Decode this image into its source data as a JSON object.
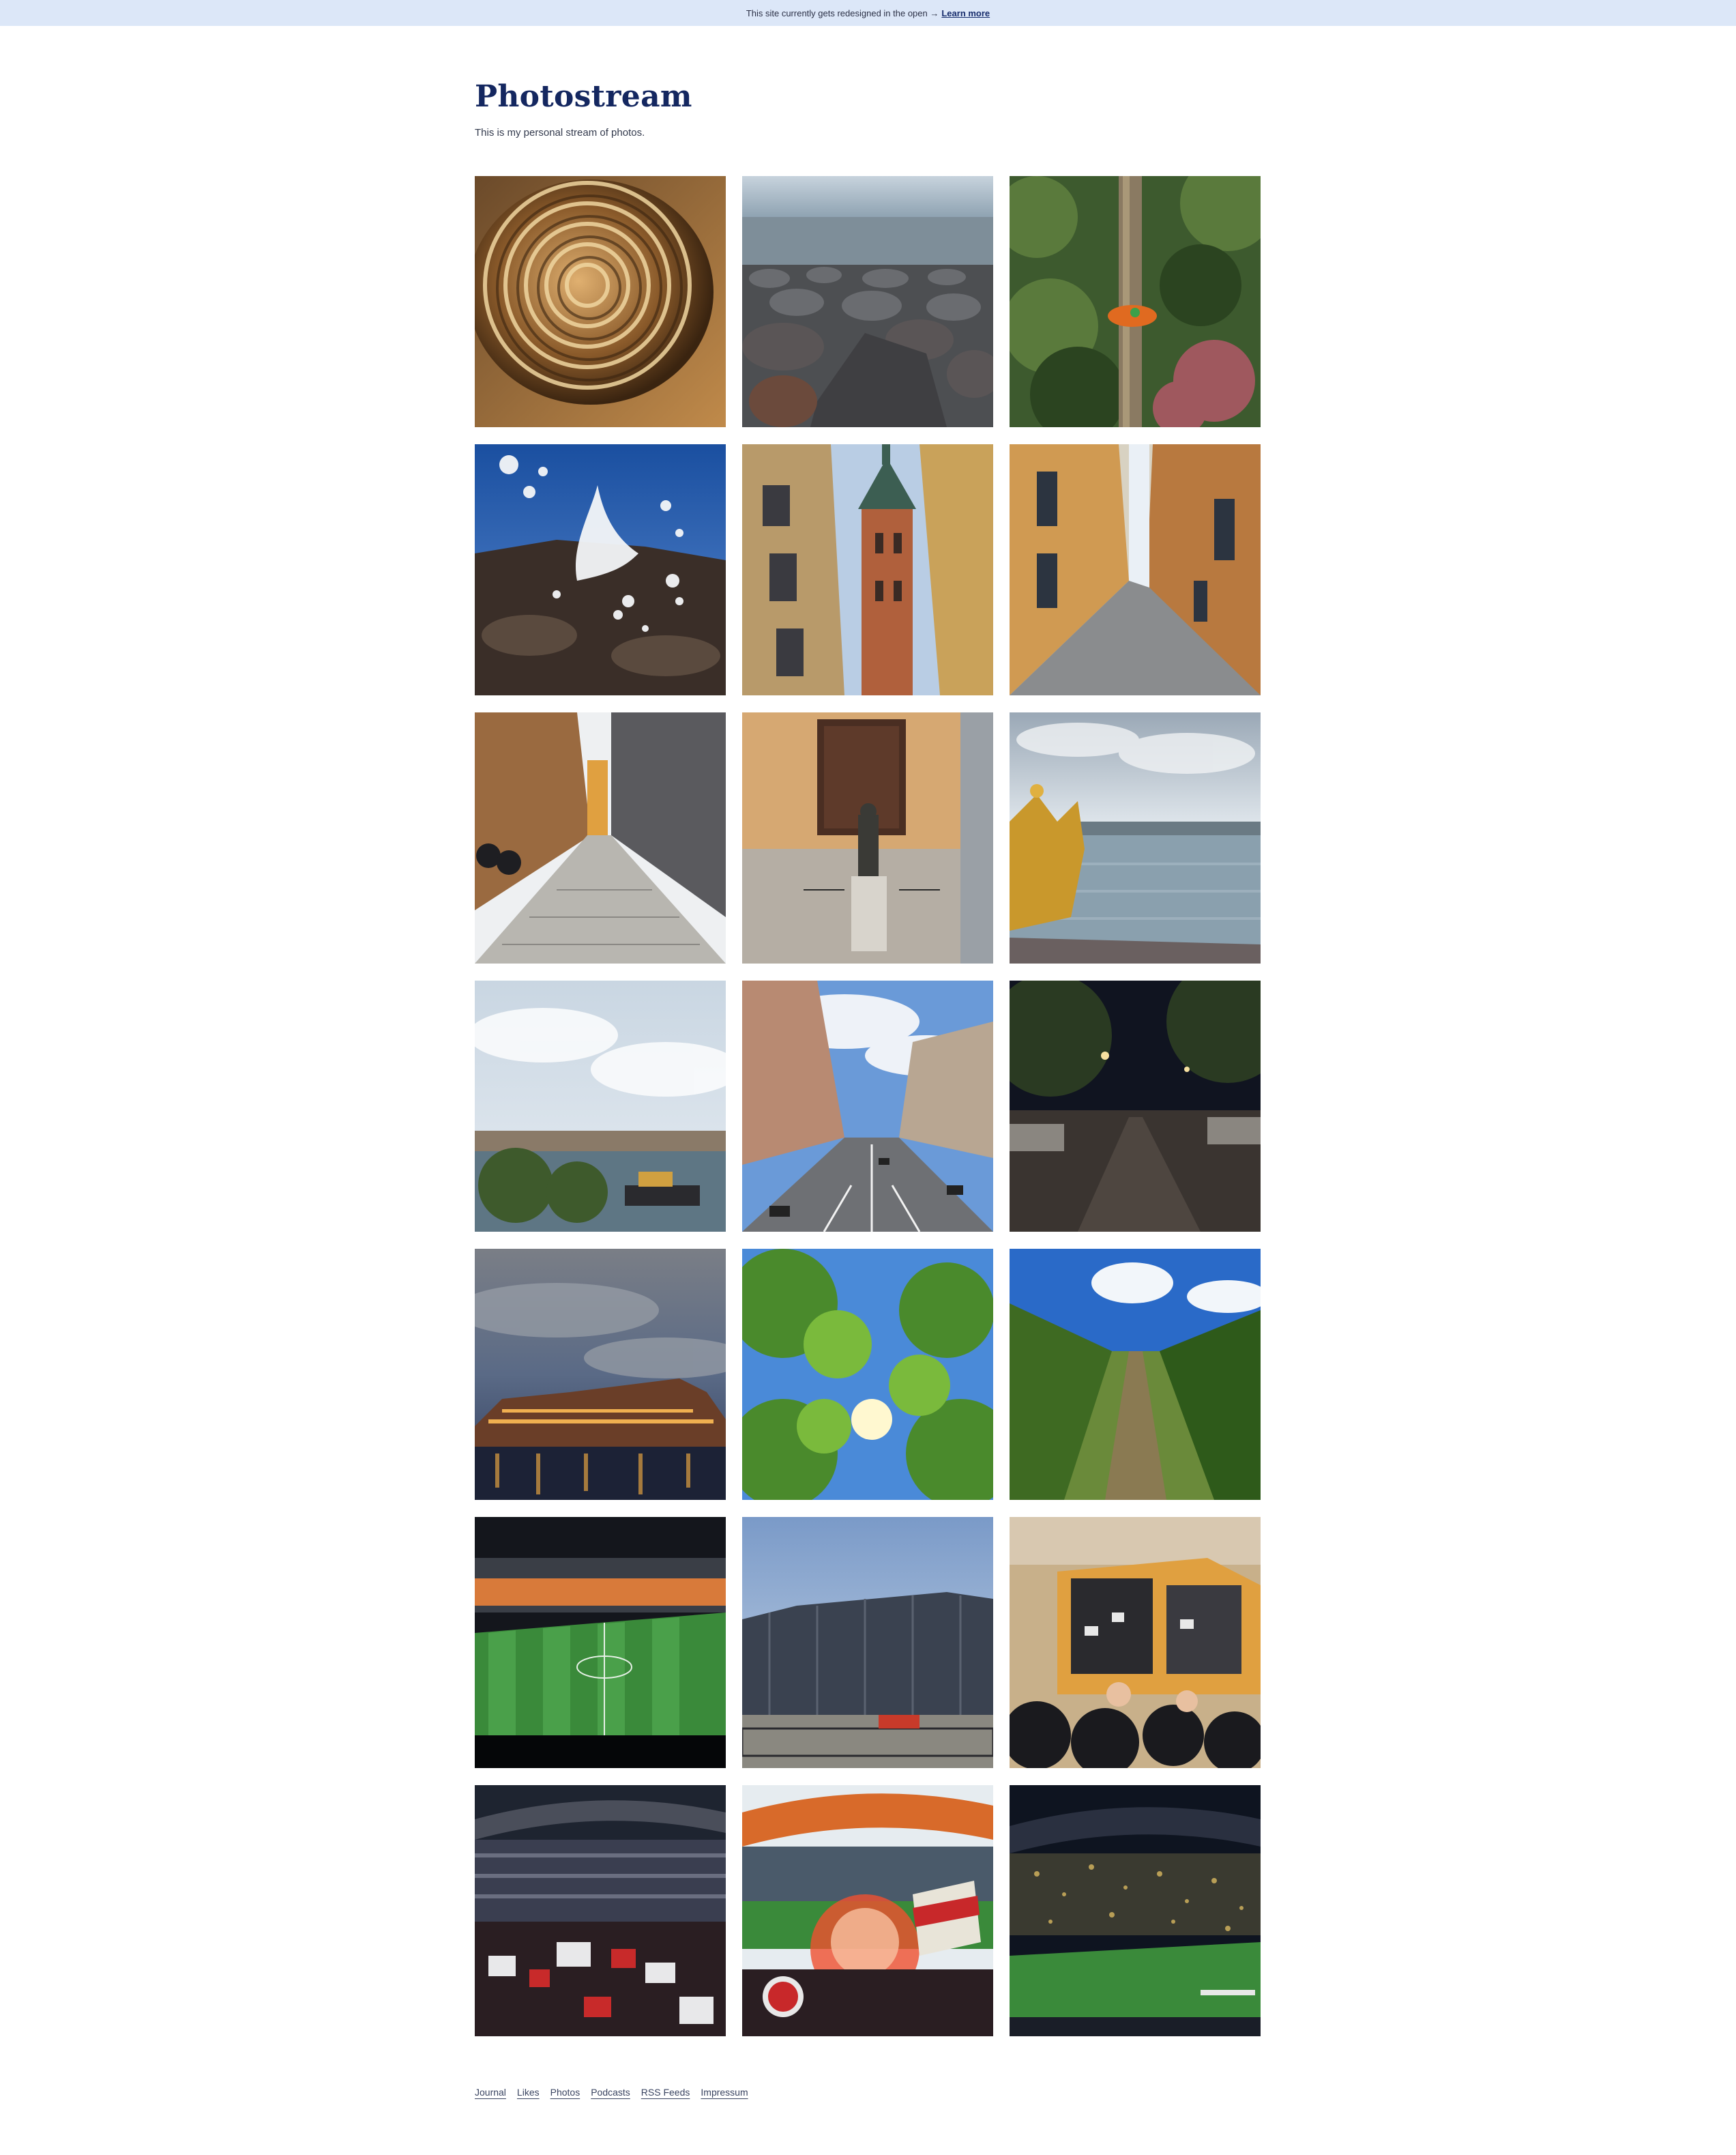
{
  "banner": {
    "text": "This site currently gets redesigned in the open →",
    "link_label": "Learn more"
  },
  "header": {
    "title": "Photostream",
    "subtitle": "This is my personal stream of photos."
  },
  "photos": [
    {
      "subject": "sourdough bread loaf"
    },
    {
      "subject": "rocky shoreline"
    },
    {
      "subject": "tree with red bird feeder"
    },
    {
      "subject": "water splash on rocks"
    },
    {
      "subject": "church tower between buildings"
    },
    {
      "subject": "narrow cobblestone alley"
    },
    {
      "subject": "cobblestone street with bikes"
    },
    {
      "subject": "statue in front of church"
    },
    {
      "subject": "golden crown by the water"
    },
    {
      "subject": "harbor under cloudy sky"
    },
    {
      "subject": "city avenue from above"
    },
    {
      "subject": "wet street at night"
    },
    {
      "subject": "waterfront buildings at dusk"
    },
    {
      "subject": "grape vines against sun"
    },
    {
      "subject": "vineyard rows"
    },
    {
      "subject": "football stadium pitch at night"
    },
    {
      "subject": "stadium exterior"
    },
    {
      "subject": "crowd at tram"
    },
    {
      "subject": "fans in stadium stands"
    },
    {
      "subject": "flare in stadium crowd"
    },
    {
      "subject": "stadium with confetti"
    }
  ],
  "footer": {
    "links": [
      "Journal",
      "Likes",
      "Photos",
      "Podcasts",
      "RSS Feeds",
      "Impressum"
    ]
  },
  "colors": {
    "banner_bg": "#dce7f8",
    "title": "#142760",
    "link": "#152b6b"
  }
}
